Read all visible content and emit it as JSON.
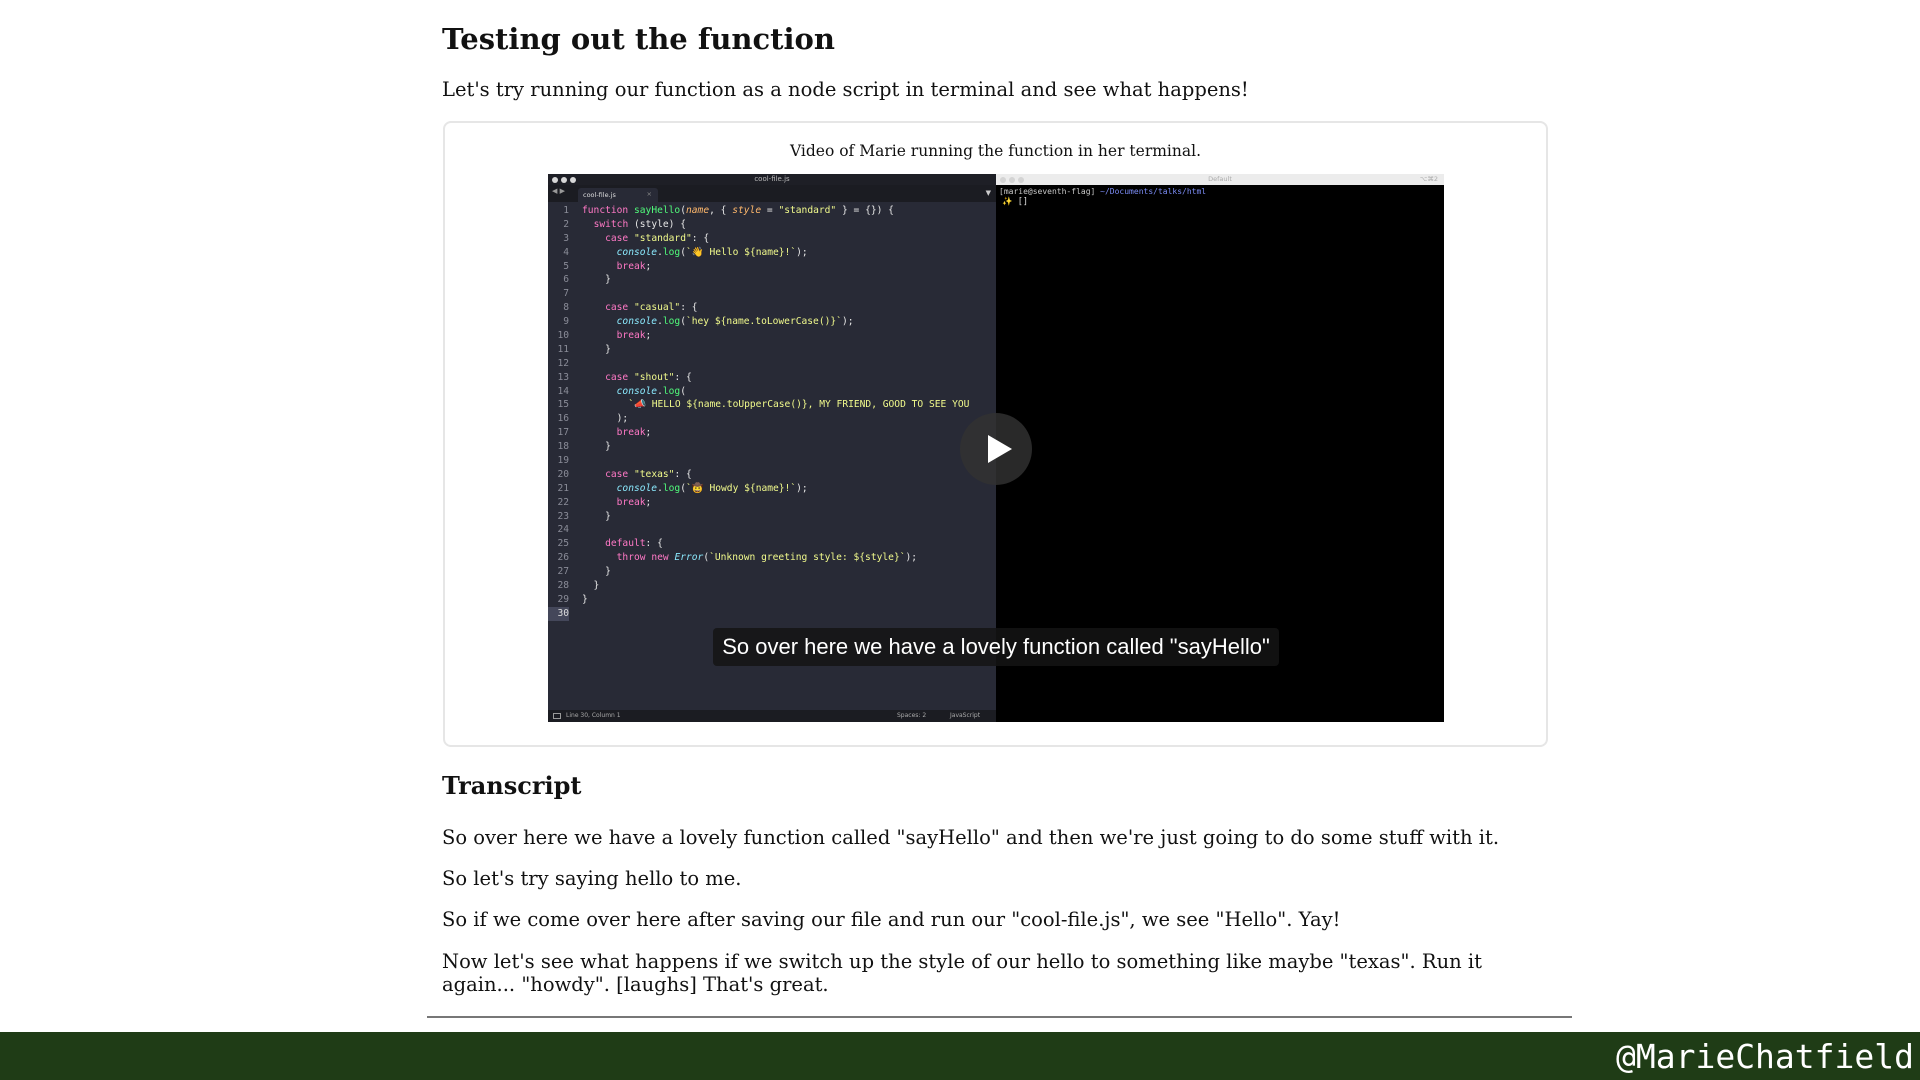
{
  "section": {
    "title": "Testing out the function",
    "intro": "Let's try running our function as a node script in terminal and see what happens!"
  },
  "video": {
    "caption": "Video of Marie running the function in her terminal.",
    "editor": {
      "window_title": "cool-file.js",
      "tab_label": "cool-file.js",
      "tab_close": "×",
      "nav_arrows": "◀ ▶",
      "status_position": "Line 30, Column 1",
      "status_spaces": "Spaces: 2",
      "status_language": "JavaScript",
      "code_lines": [
        "function sayHello(name, { style = \"standard\" } = {}) {",
        "  switch (style) {",
        "    case \"standard\": {",
        "      console.log(`👋 Hello ${name}!`);",
        "      break;",
        "    }",
        "",
        "    case \"casual\": {",
        "      console.log(`hey ${name.toLowerCase()}`);",
        "      break;",
        "    }",
        "",
        "    case \"shout\": {",
        "      console.log(",
        "        `📣 HELLO ${name.toUpperCase()}, MY FRIEND, GOOD TO SEE YOU",
        "      );",
        "      break;",
        "    }",
        "",
        "    case \"texas\": {",
        "      console.log(`🤠 Howdy ${name}!`);",
        "      break;",
        "    }",
        "",
        "    default: {",
        "      throw new Error(`Unknown greeting style: ${style}`);",
        "    }",
        "  }",
        "}",
        ""
      ]
    },
    "terminal": {
      "window_title": "Default",
      "shortcut": "⌥⌘2",
      "prompt_user": "[marie@seventh-flag] ",
      "prompt_path": "~/Documents/talks/html",
      "cursor_line": "✨ []"
    },
    "subtitle": "So over here we have a lovely function called \"sayHello\"",
    "play_icon": "play-icon"
  },
  "transcript": {
    "title": "Transcript",
    "paragraphs": [
      "So over here we have a lovely function called \"sayHello\" and then we're just going to do some stuff with it.",
      "So let's try saying hello to me.",
      "So if we come over here after saving our file and run our \"cool-file.js\", we see \"Hello\". Yay!",
      "Now let's see what happens if we switch up the style of our hello to something like maybe \"texas\". Run it again... \"howdy\". [laughs] That's great."
    ]
  },
  "footer": {
    "handle": "@MarieChatfield",
    "background": "#1f3c16"
  }
}
